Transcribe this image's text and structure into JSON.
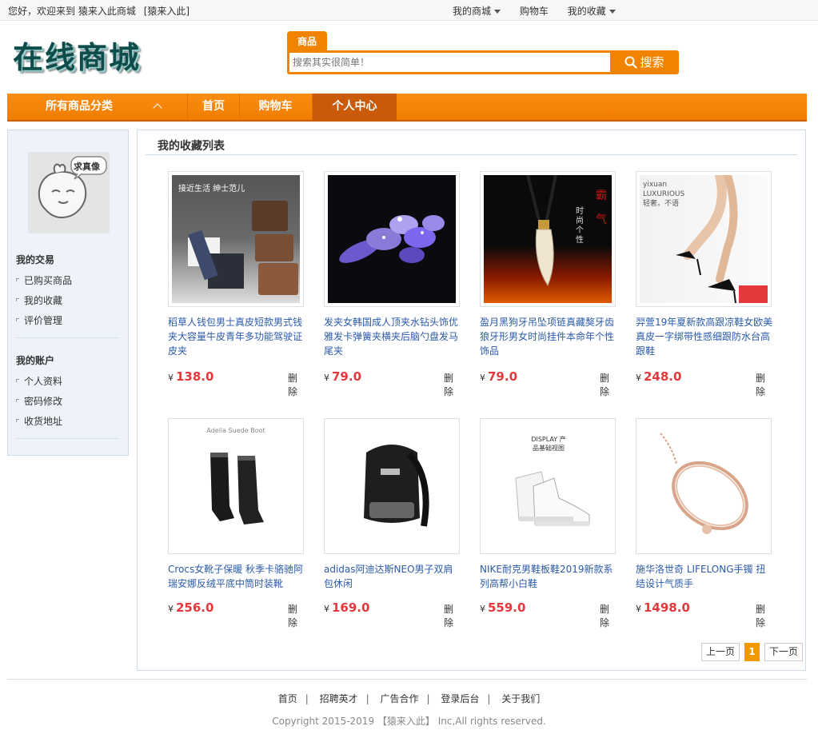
{
  "topbar": {
    "welcome": "您好，欢迎来到",
    "site_name": "猿来入此商城",
    "user": "[猿来入此]",
    "links": [
      "我的商城",
      "购物车",
      "我的收藏"
    ]
  },
  "logo": {
    "text": "在线商城",
    "icon": "site-logo"
  },
  "search": {
    "tab": "商品",
    "placeholder": "搜索其实很简单！",
    "button": "搜索",
    "icon": "search-icon"
  },
  "nav": {
    "all_categories": "所有商品分类",
    "items": [
      "首页",
      "购物车",
      "个人中心"
    ],
    "active": "个人中心"
  },
  "sidebar": {
    "avatar_caption": "求真像",
    "sections": [
      {
        "title": "我的交易",
        "items": [
          "已购买商品",
          "我的收藏",
          "评价管理"
        ]
      },
      {
        "title": "我的账户",
        "items": [
          "个人资料",
          "密码修改",
          "收货地址"
        ]
      }
    ]
  },
  "main": {
    "title": "我的收藏列表",
    "currency": "¥",
    "delete_label": "删除",
    "products": [
      {
        "name": "稻草人钱包男士真皮短款男式钱夹大容量牛皮青年多功能驾驶证皮夹",
        "price": "138.0",
        "image_text": "接近生活 绅士范儿"
      },
      {
        "name": "发夹女韩国成人顶夹水钻头饰优雅发卡弹簧夹横夹后脑勺盘发马尾夹",
        "price": "79.0",
        "image_text": ""
      },
      {
        "name": "盈月黑狗牙吊坠项链真藏獒牙齿狼牙形男女时尚挂件本命年个性饰品",
        "price": "79.0",
        "image_text": "时尚 个性"
      },
      {
        "name": "羿萱19年夏新款高跟凉鞋女欧美真皮一字绑带性感细跟防水台高跟鞋",
        "price": "248.0",
        "image_text": "yixuan LUXURIOUS 轻奢。不语"
      },
      {
        "name": "Crocs女靴子保暖 秋季卡骆驰阿瑞安娜反绒平底中筒时装靴",
        "price": "256.0",
        "image_text": "Adelia Suede Boot"
      },
      {
        "name": "adidas阿迪达斯NEO男子双肩包休闲",
        "price": "169.0",
        "image_text": ""
      },
      {
        "name": "NIKE耐克男鞋板鞋2019新款系列高帮小白鞋",
        "price": "559.0",
        "image_text": "DISPLAY 产品基础视图"
      },
      {
        "name": "施华洛世奇 LIFELONG手镯 扭结设计气质手",
        "price": "1498.0",
        "image_text": ""
      }
    ]
  },
  "pagination": {
    "prev": "上一页",
    "current": "1",
    "next": "下一页"
  },
  "footer": {
    "links": [
      "首页",
      "招聘英才",
      "广告合作",
      "登录后台",
      "关于我们"
    ],
    "copyright": "Copyright 2015-2019 【猿来入此】 Inc,All rights reserved."
  },
  "colors": {
    "accent": "#f08300",
    "nav_active": "#c95a0a",
    "link": "#2b5aa8",
    "price": "#e4393c"
  }
}
